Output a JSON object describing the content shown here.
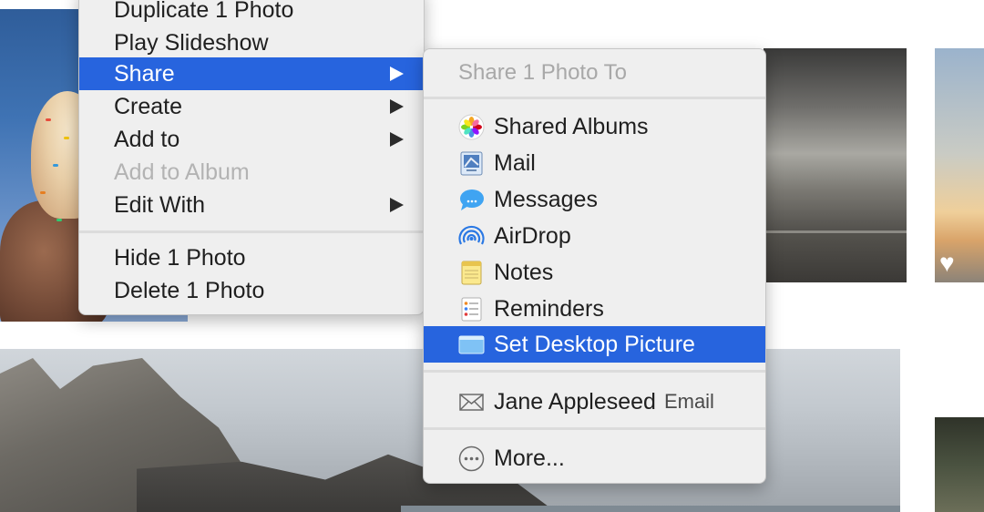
{
  "main_menu": {
    "items": [
      {
        "label": "Duplicate 1 Photo",
        "disabled": false,
        "submenu": false,
        "selected": false
      },
      {
        "label": "Play Slideshow",
        "disabled": false,
        "submenu": false,
        "selected": false
      },
      {
        "label": "Share",
        "disabled": false,
        "submenu": true,
        "selected": true
      },
      {
        "label": "Create",
        "disabled": false,
        "submenu": true,
        "selected": false
      },
      {
        "label": "Add to",
        "disabled": false,
        "submenu": true,
        "selected": false
      },
      {
        "label": "Add to Album",
        "disabled": true,
        "submenu": false,
        "selected": false
      },
      {
        "label": "Edit With",
        "disabled": false,
        "submenu": true,
        "selected": false
      },
      {
        "label": "Hide 1 Photo",
        "disabled": false,
        "submenu": false,
        "selected": false
      },
      {
        "label": "Delete 1 Photo",
        "disabled": false,
        "submenu": false,
        "selected": false
      }
    ]
  },
  "share_menu": {
    "header": "Share 1 Photo To",
    "items": [
      {
        "label": "Shared Albums",
        "icon": "photos-icon"
      },
      {
        "label": "Mail",
        "icon": "mail-icon"
      },
      {
        "label": "Messages",
        "icon": "messages-icon"
      },
      {
        "label": "AirDrop",
        "icon": "airdrop-icon"
      },
      {
        "label": "Notes",
        "icon": "notes-icon"
      },
      {
        "label": "Reminders",
        "icon": "reminders-icon"
      },
      {
        "label": "Set Desktop Picture",
        "icon": "desktop-picture-icon",
        "selected": true
      }
    ],
    "contact": {
      "name": "Jane Appleseed",
      "method": "Email",
      "icon": "envelope-icon"
    },
    "more_label": "More...",
    "more_icon": "ellipsis-circle-icon"
  },
  "colors": {
    "highlight": "#2764de",
    "menu_bg": "#efefef",
    "disabled_text": "#b3b3b3"
  }
}
